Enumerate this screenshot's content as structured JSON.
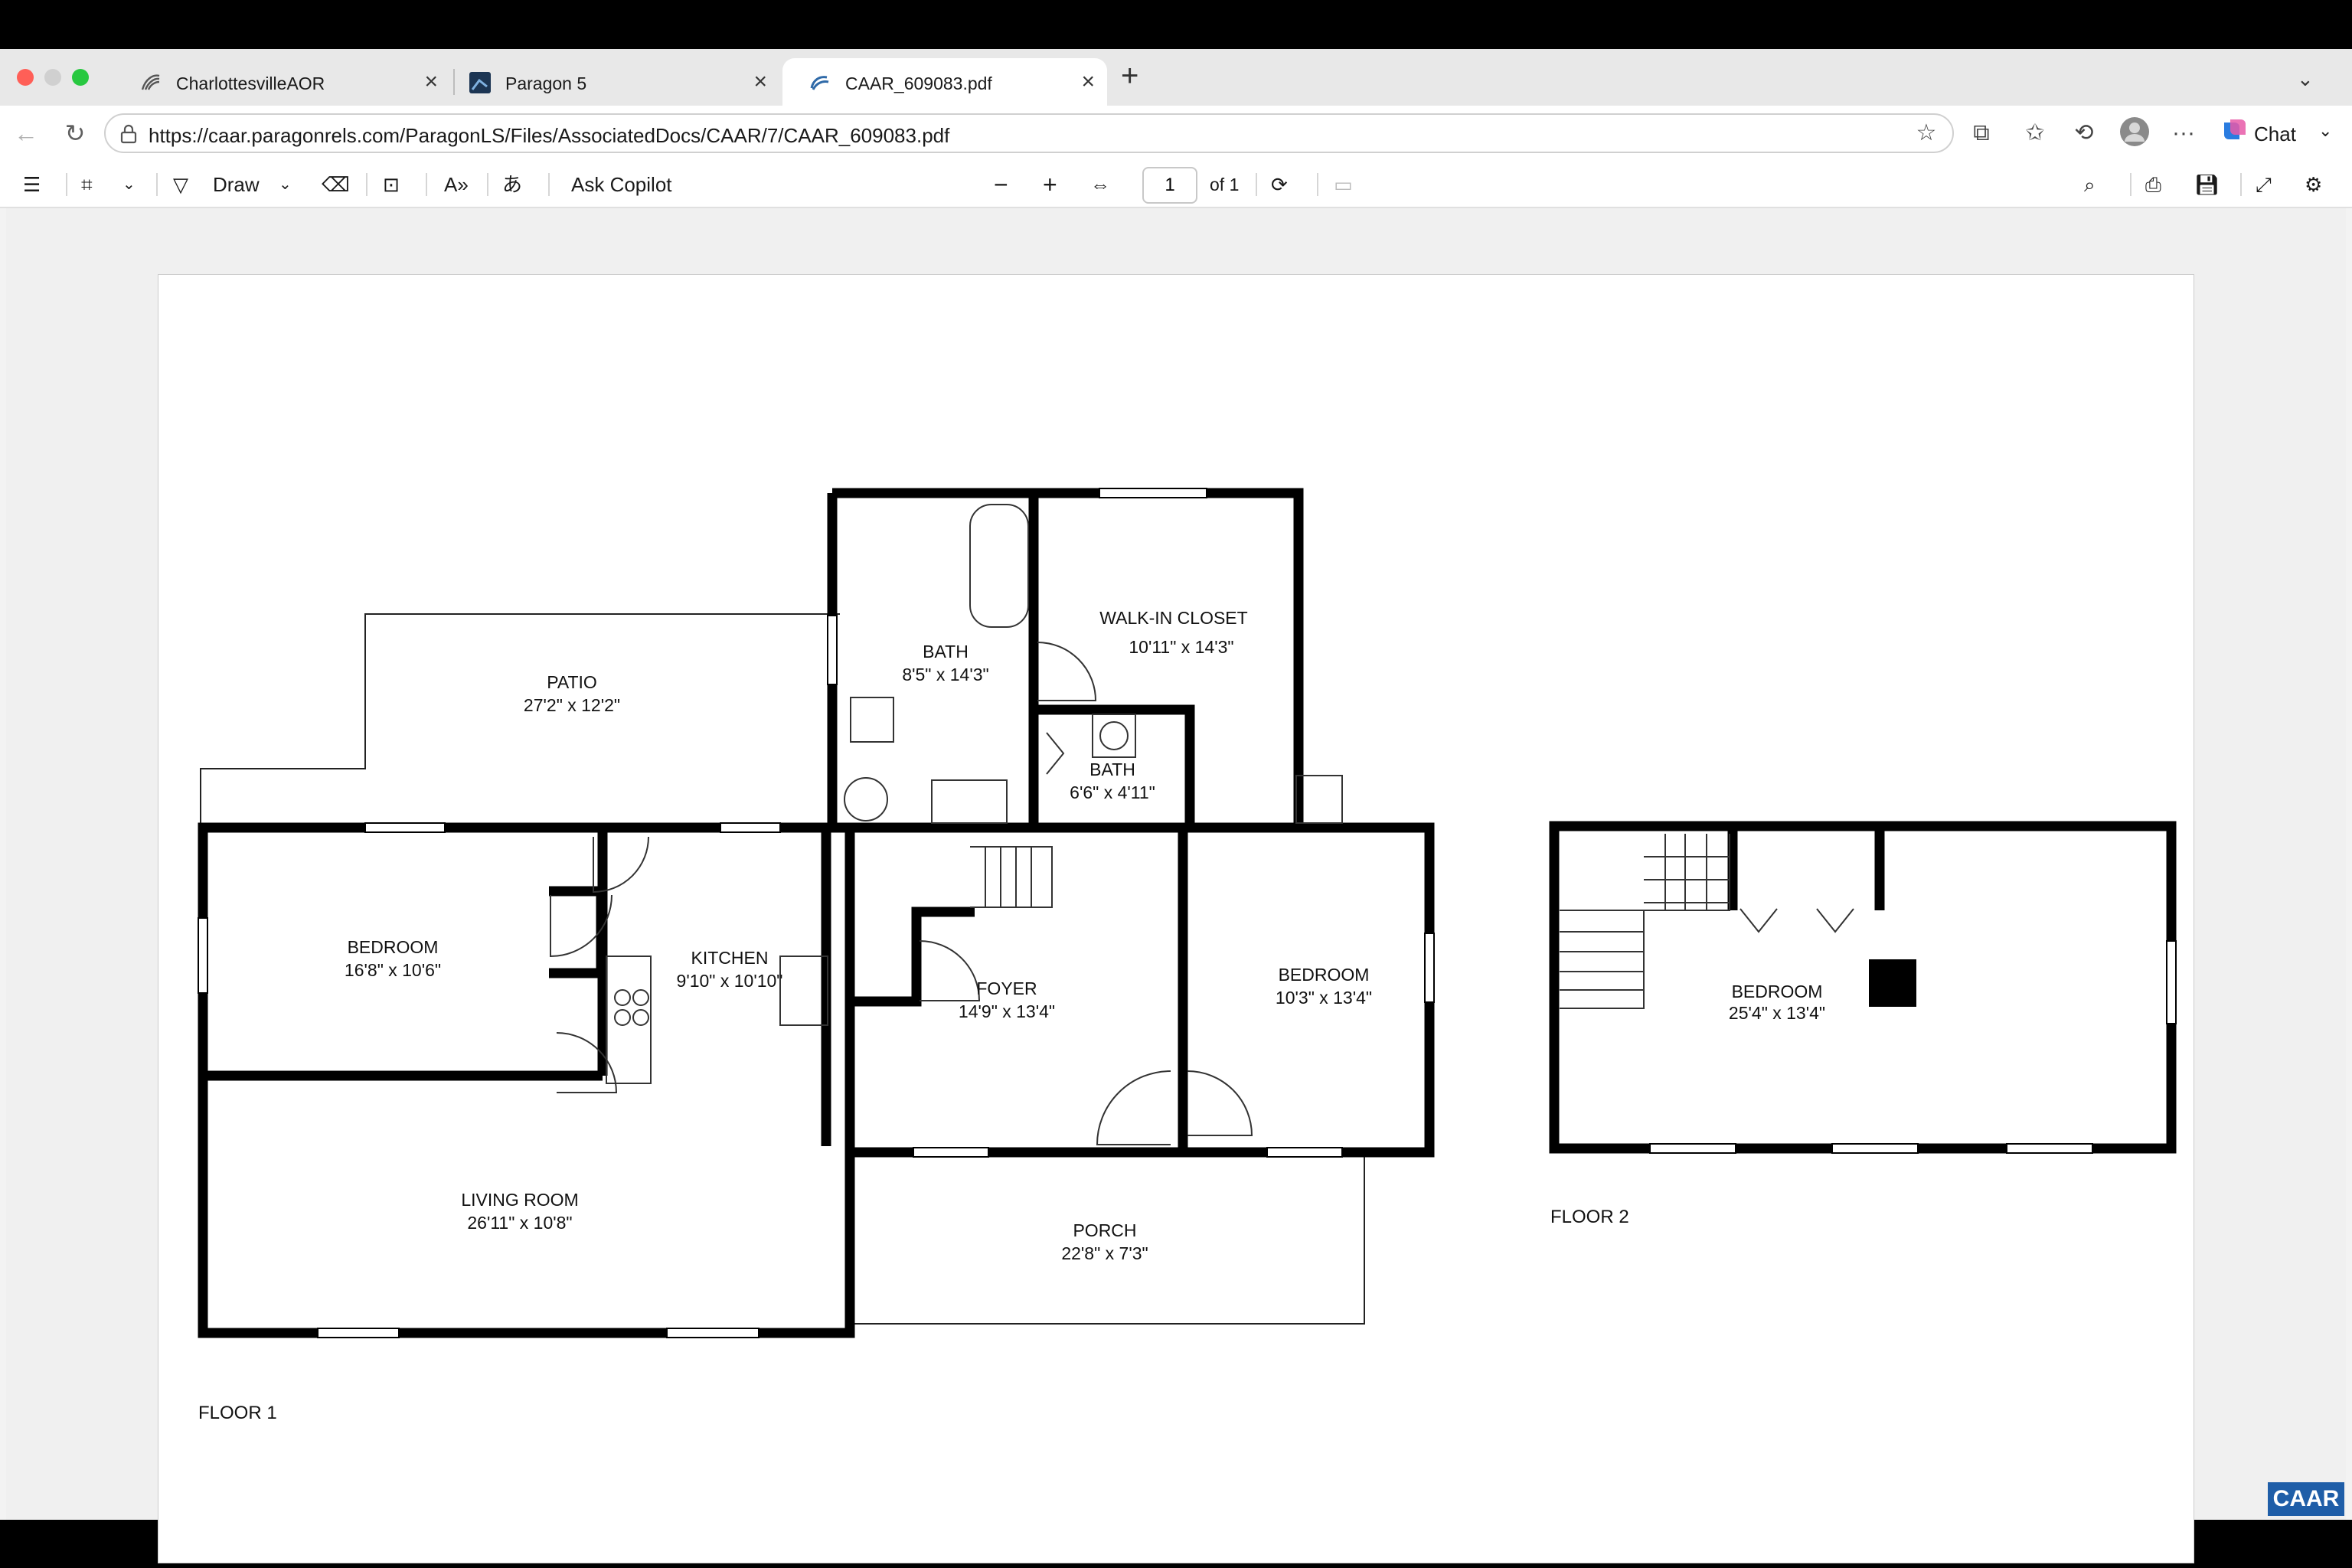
{
  "browser": {
    "tabs": [
      {
        "title": "CharlottesvilleAOR",
        "icon": "caar-logo-icon"
      },
      {
        "title": "Paragon 5",
        "icon": "paragon-icon"
      },
      {
        "title": "CAAR_609083.pdf",
        "icon": "pdf-icon",
        "active": true
      }
    ],
    "url": "https://caar.paragonrels.com/ParagonLS/Files/AssociatedDocs/CAAR/7/CAAR_609083.pdf",
    "chat_label": "Chat"
  },
  "pdf_toolbar": {
    "draw_label": "Draw",
    "ask_copilot_label": "Ask Copilot",
    "page_current": "1",
    "page_total": "of 1"
  },
  "floorplan": {
    "rooms": [
      {
        "name": "PATIO",
        "dims": "27'2\" x 12'2\""
      },
      {
        "name": "BATH",
        "dims": "8'5\" x 14'3\""
      },
      {
        "name": "WALK-IN CLOSET",
        "dims": "10'11\" x 14'3\""
      },
      {
        "name": "BATH",
        "dims": "6'6\" x 4'11\""
      },
      {
        "name": "BEDROOM",
        "dims": "16'8\" x 10'6\""
      },
      {
        "name": "KITCHEN",
        "dims": "9'10\" x 10'10\""
      },
      {
        "name": "FOYER",
        "dims": "14'9\" x 13'4\""
      },
      {
        "name": "BEDROOM",
        "dims": "10'3\" x 13'4\""
      },
      {
        "name": "LIVING ROOM",
        "dims": "26'11\" x 10'8\""
      },
      {
        "name": "PORCH",
        "dims": "22'8\" x 7'3\""
      },
      {
        "name": "BEDROOM",
        "dims": "25'4\" x 13'4\""
      }
    ],
    "floor1_label": "FLOOR 1",
    "floor2_label": "FLOOR 2",
    "brand_logo": "CAAR"
  },
  "colors": {
    "wall": "#000000",
    "brand": "#1f5ea8"
  }
}
